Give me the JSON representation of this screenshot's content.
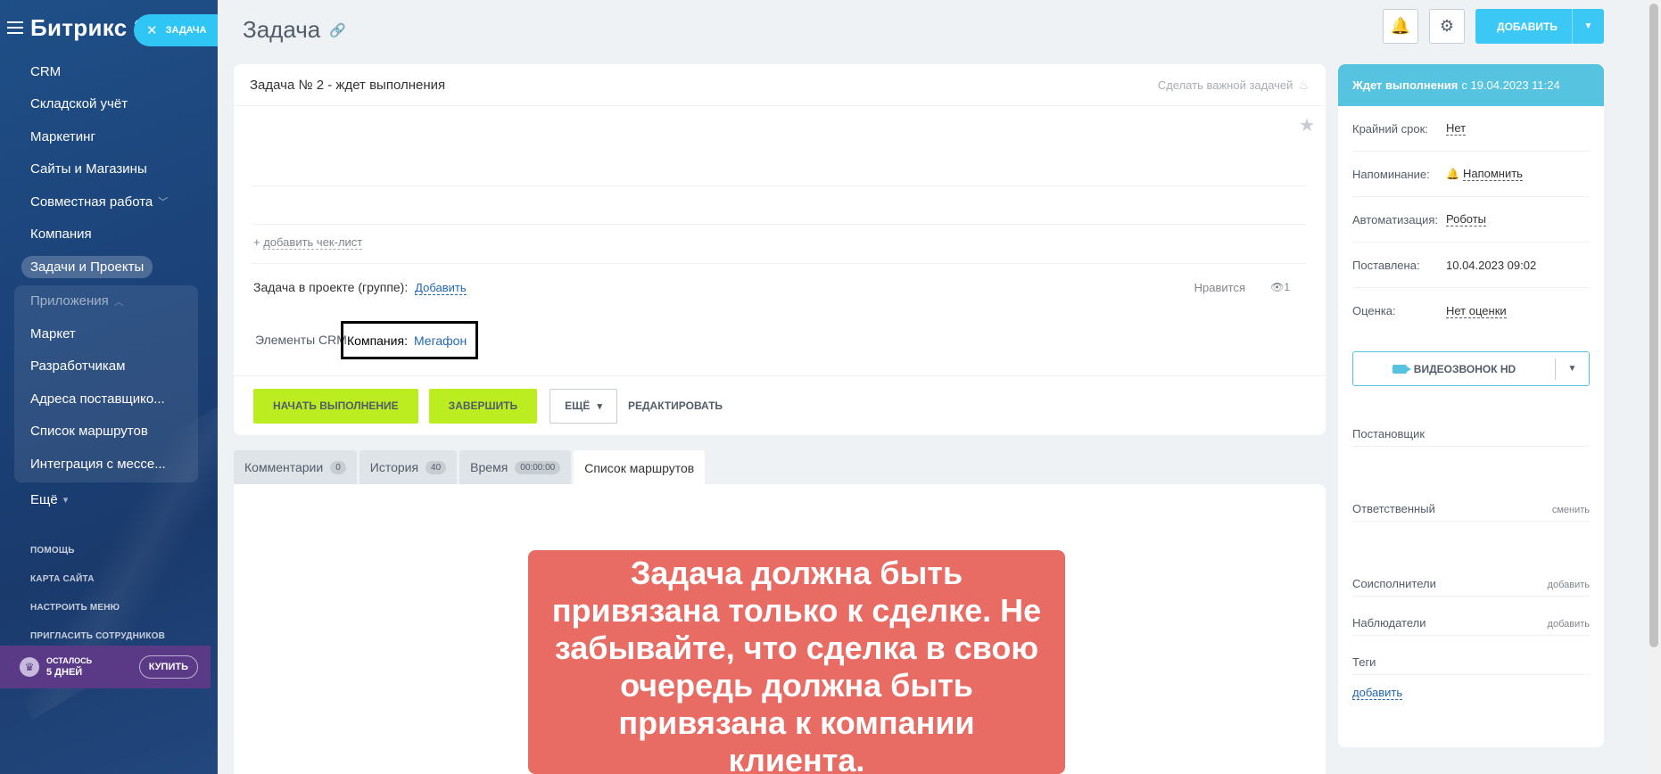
{
  "sidebar": {
    "brand": "Битрикс 2",
    "task_chip": "ЗАДАЧА",
    "items": [
      {
        "label": "CRM"
      },
      {
        "label": "Складской учёт"
      },
      {
        "label": "Маркетинг"
      },
      {
        "label": "Сайты и Магазины"
      },
      {
        "label": "Совместная работа"
      },
      {
        "label": "Компания"
      },
      {
        "label": "Задачи и Проекты"
      }
    ],
    "apps_header": "Приложения",
    "apps": [
      {
        "label": "Маркет"
      },
      {
        "label": "Разработчикам"
      },
      {
        "label": "Адреса поставщико..."
      },
      {
        "label": "Список маршрутов"
      },
      {
        "label": "Интеграция с мессе..."
      }
    ],
    "more": "Ещё",
    "footer_links": [
      "ПОМОЩЬ",
      "КАРТА САЙТА",
      "НАСТРОИТЬ МЕНЮ",
      "ПРИГЛАСИТЬ СОТРУДНИКОВ"
    ],
    "trial": {
      "line1": "ОСТАЛОСЬ",
      "line2": "5 ДНЕЙ",
      "buy": "КУПИТЬ"
    }
  },
  "header": {
    "title": "Задача",
    "add_button": "ДОБАВИТЬ"
  },
  "task": {
    "title": "Задача № 2 - ждет выполнения",
    "make_important": "Сделать важной задачей",
    "add_checklist": "добавить чек-лист",
    "project_label": "Задача в проекте (группе):",
    "project_add": "Добавить",
    "likes": "Нравится",
    "views": "1",
    "crm_label": "Элементы CRM",
    "crm_company_label": "Компания:",
    "crm_company_value": "Мегафон",
    "buttons": {
      "start": "НАЧАТЬ ВЫПОЛНЕНИЕ",
      "finish": "ЗАВЕРШИТЬ",
      "more": "ЕЩЁ",
      "edit": "РЕДАКТИРОВАТЬ"
    }
  },
  "tabs": [
    {
      "label": "Комментарии",
      "count": "0"
    },
    {
      "label": "История",
      "count": "40"
    },
    {
      "label": "Время",
      "count": "00:00:00"
    },
    {
      "label": "Список маршрутов",
      "count": ""
    }
  ],
  "banner": "Задача должна быть привязана только к сделке. Не забывайте, что сделка в свою очередь должна быть привязана к компании клиента.",
  "right_panel": {
    "status_bold": "Ждет выполнения",
    "status_rest": "с 19.04.2023 11:24",
    "rows": [
      {
        "key": "Крайний срок:",
        "value": "Нет"
      },
      {
        "key": "Напоминание:",
        "value": "Напомнить"
      },
      {
        "key": "Автоматизация:",
        "value": "Роботы"
      },
      {
        "key": "Поставлена:",
        "value": "10.04.2023 09:02"
      },
      {
        "key": "Оценка:",
        "value": "Нет оценки"
      }
    ],
    "video_button": "ВИДЕОЗВОНОК HD",
    "creator": "Постановщик",
    "responsible": "Ответственный",
    "responsible_action": "сменить",
    "coexecutors": "Соисполнители",
    "coexecutors_action": "добавить",
    "observers": "Наблюдатели",
    "observers_action": "добавить",
    "tags": "Теги",
    "tags_add": "добавить"
  },
  "colors": {
    "accent": "#2fc6f6",
    "green": "#bbed21",
    "banner": "#e86b64",
    "status": "#56c3e0"
  }
}
